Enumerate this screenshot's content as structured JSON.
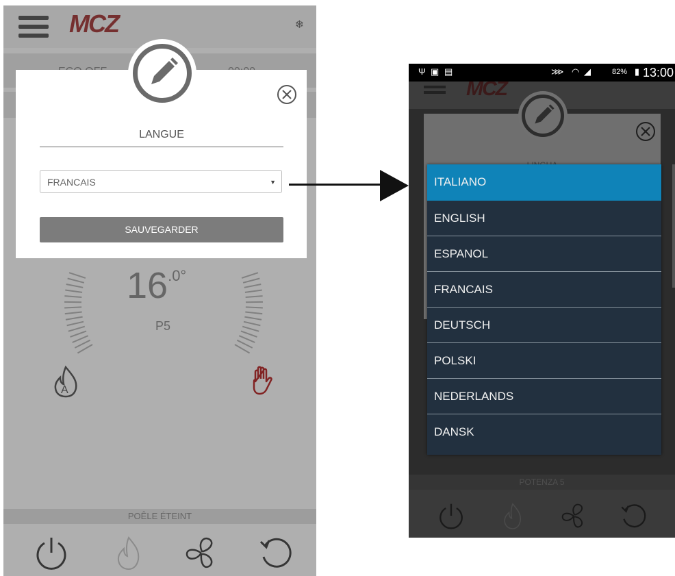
{
  "left_app": {
    "logo": "MCZ",
    "header_left": "ECO OFF",
    "header_right": "00:00",
    "temperature_int": "16",
    "temperature_dec": ".0°",
    "power_level": "P5",
    "status_text": "POÊLE ÉTEINT"
  },
  "dialog": {
    "title": "LANGUE",
    "selected_language": "FRANCAIS",
    "save_label": "SAUVEGARDER"
  },
  "phone": {
    "status_bar": {
      "time": "13:00",
      "battery": "82%"
    },
    "app_logo": "MCZ",
    "dialog_title": "LINGUA",
    "status_text": "POTENZA 5",
    "language_options": [
      {
        "label": "ITALIANO",
        "selected": true
      },
      {
        "label": "ENGLISH",
        "selected": false
      },
      {
        "label": "ESPANOL",
        "selected": false
      },
      {
        "label": "FRANCAIS",
        "selected": false
      },
      {
        "label": "DEUTSCH",
        "selected": false
      },
      {
        "label": "POLSKI",
        "selected": false
      },
      {
        "label": "NEDERLANDS",
        "selected": false
      },
      {
        "label": "DANSK",
        "selected": false
      }
    ]
  },
  "colors": {
    "brand_red": "#8b2a2a",
    "selected_blue": "#0f83b8",
    "dropdown_bg": "#22303f",
    "button_gray": "#7c7c7c"
  },
  "icons": [
    "menu-icon",
    "snowflake-icon",
    "pencil-icon",
    "close-icon",
    "auto-flame-icon",
    "hand-icon",
    "power-icon",
    "flame-icon",
    "fan-icon",
    "refresh-icon"
  ]
}
